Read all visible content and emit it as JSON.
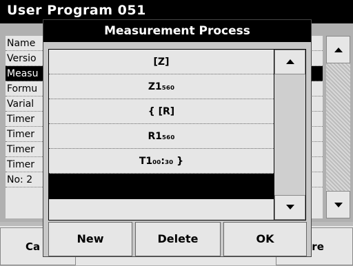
{
  "background": {
    "title": "User Program  051",
    "rows": [
      {
        "label": "Name",
        "selected": false
      },
      {
        "label": "Versio",
        "selected": false
      },
      {
        "label": "Measu",
        "selected": true
      },
      {
        "label": "Formu",
        "selected": false
      },
      {
        "label": "Varial",
        "selected": false
      },
      {
        "label": "Timer",
        "selected": false
      },
      {
        "label": "Timer",
        "selected": false
      },
      {
        "label": "Timer",
        "selected": false
      },
      {
        "label": "Timer",
        "selected": false
      },
      {
        "label": "No: 2",
        "selected": false
      }
    ],
    "buttons": {
      "left": "Ca",
      "right": "ore"
    }
  },
  "dialog": {
    "title": "Measurement Process",
    "steps": [
      "[Z]",
      "Z1₅₆₀",
      "{ [R]",
      "R1₅₆₀",
      "T1₀₀:₃₀ }"
    ],
    "buttons": {
      "new": "New",
      "delete": "Delete",
      "ok": "OK"
    }
  },
  "colors": {
    "title_bar": "#000000",
    "panel": "#e6e6e6",
    "background": "#b0b0b0"
  }
}
